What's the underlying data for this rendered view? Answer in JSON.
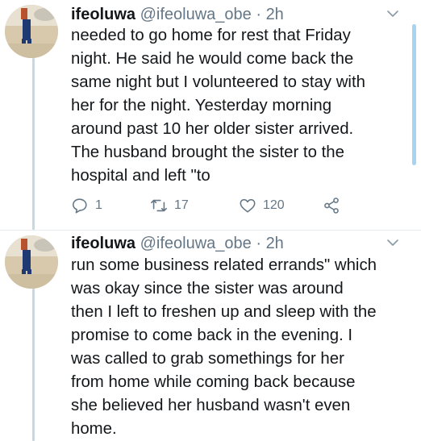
{
  "tweets": [
    {
      "name": "ifeoluwa",
      "handle": "@ifeoluwa_obe",
      "separator": "·",
      "time": "2h",
      "lines": [
        "needed to go home for rest that Friday",
        "night. He said he would come back the",
        "same night but I volunteered to stay with",
        "her for the night. Yesterday morning",
        "around past 10 her older sister arrived.",
        "The husband brought the sister to the",
        "hospital and left \"to"
      ],
      "reply_count": "1",
      "retweet_count": "17",
      "like_count": "120"
    },
    {
      "name": "ifeoluwa",
      "handle": "@ifeoluwa_obe",
      "separator": "·",
      "time": "2h",
      "lines": [
        "run some business related errands\" which",
        "was okay since the sister was around",
        "then I left to freshen up and sleep with the",
        "promise to come back in the evening. I",
        "was called to grab somethings for her",
        "from home while coming back because",
        "she believed her husband wasn't even",
        "home."
      ]
    }
  ],
  "icons": {
    "reply": "reply-icon",
    "retweet": "retweet-icon",
    "like": "heart-icon",
    "share": "share-icon",
    "more": "chevron-down-icon"
  },
  "colors": {
    "text": "#14171a",
    "secondary": "#657786",
    "thread_line": "#ccd6dd",
    "scrollbar": "#a6d4f2"
  }
}
